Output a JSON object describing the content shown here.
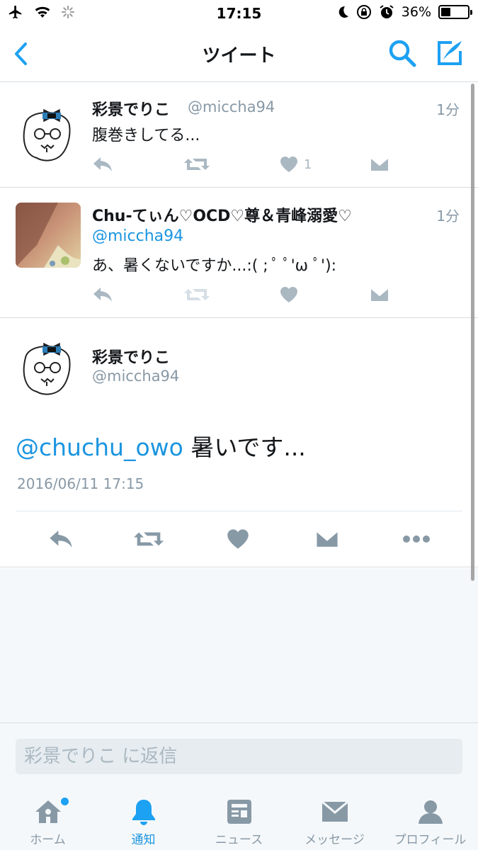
{
  "status_bar": {
    "time": "17:15",
    "battery_text": "36%",
    "battery_level": 0.36,
    "left_icons": [
      "airplane-icon",
      "wifi-icon",
      "loading-spinner-icon"
    ],
    "right_icons": [
      "moon-icon",
      "rotation-lock-icon",
      "alarm-icon"
    ]
  },
  "nav": {
    "title": "ツイート",
    "back_icon": "chevron-left-icon",
    "search_icon": "search-icon",
    "compose_icon": "compose-icon",
    "accent": "#1da1f2"
  },
  "tweets": [
    {
      "name": "彩景でりこ",
      "handle": "@miccha94",
      "time": "1分",
      "text": "腹巻きしてる...",
      "like_count": "1"
    },
    {
      "name": "Chu-てぃん♡OCD♡尊＆青峰溺愛♡",
      "handle": "",
      "time": "1分",
      "mention": "@miccha94",
      "text": "あ、暑くないですか...:( ; ﾟ ﾟ'ω ﾟ'):",
      "like_count": ""
    }
  ],
  "detail": {
    "name": "彩景でりこ",
    "handle": "@miccha94",
    "mention": "@chuchu_owo",
    "text": " 暑いです...",
    "date": "2016/06/11 17:15",
    "actions": [
      "reply-icon",
      "retweet-icon",
      "like-icon",
      "direct-message-icon",
      "more-icon"
    ]
  },
  "reply": {
    "placeholder": "彩景でりこ に返信"
  },
  "tabs": [
    {
      "label": "ホーム",
      "icon": "home-icon",
      "active": false,
      "badge": true
    },
    {
      "label": "通知",
      "icon": "bell-icon",
      "active": true,
      "badge": false
    },
    {
      "label": "ニュース",
      "icon": "news-icon",
      "active": false,
      "badge": false
    },
    {
      "label": "メッセージ",
      "icon": "messages-icon",
      "active": false,
      "badge": false
    },
    {
      "label": "プロフィール",
      "icon": "profile-icon",
      "active": false,
      "badge": false
    }
  ]
}
